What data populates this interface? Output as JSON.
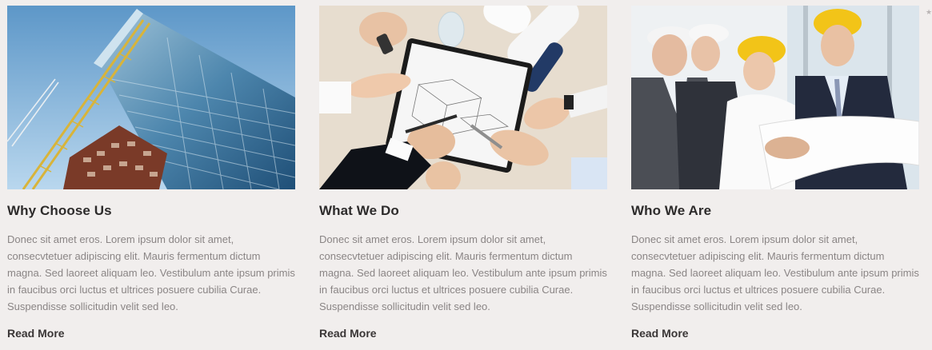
{
  "cards": [
    {
      "image": "building-crane-photo",
      "title": "Why Choose Us",
      "text": "Donec sit amet eros. Lorem ipsum dolor sit amet, consecvtetuer adipiscing elit. Mauris fermentum dictum magna. Sed laoreet aliquam leo. Vestibulum ante ipsum primis in faucibus orci luctus et ultrices posuere cubilia Curae. Suspendisse sollicitudin velit sed leo.",
      "link": "Read More"
    },
    {
      "image": "blueprint-meeting-photo",
      "title": "What We Do",
      "text": "Donec sit amet eros. Lorem ipsum dolor sit amet, consecvtetuer adipiscing elit. Mauris fermentum dictum magna. Sed laoreet aliquam leo. Vestibulum ante ipsum primis in faucibus orci luctus et ultrices posuere cubilia Curae. Suspendisse sollicitudin velit sed leo.",
      "link": "Read More"
    },
    {
      "image": "engineers-team-photo",
      "title": "Who We Are",
      "text": "Donec sit amet eros. Lorem ipsum dolor sit amet, consecvtetuer adipiscing elit. Mauris fermentum dictum magna. Sed laoreet aliquam leo. Vestibulum ante ipsum primis in faucibus orci luctus et ultrices posuere cubilia Curae. Suspendisse sollicitudin velit sed leo.",
      "link": "Read More"
    }
  ],
  "colors": {
    "page_background": "#f1eeed",
    "title": "#2d2b2b",
    "body_text": "#8a8585",
    "link": "#3a3636",
    "sky": "#7fb3da",
    "crane": "#d8b43a",
    "hardhat": "#f2c418"
  },
  "edge_icon": "star-icon"
}
